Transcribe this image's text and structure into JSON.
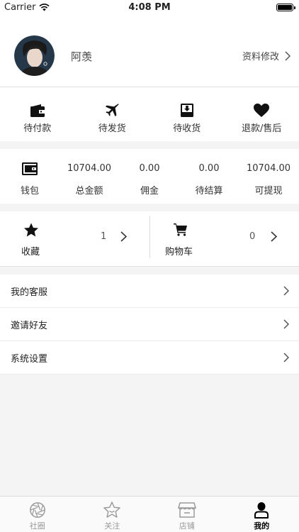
{
  "status_bar": {
    "carrier": "Carrier",
    "time": "4:08 PM"
  },
  "profile": {
    "name": "阿羡",
    "edit_label": "资料修改"
  },
  "orders": [
    {
      "label": "待付款",
      "icon": "wallet-icon"
    },
    {
      "label": "待发货",
      "icon": "airplane-icon"
    },
    {
      "label": "待收货",
      "icon": "inbox-download-icon"
    },
    {
      "label": "退款/售后",
      "icon": "heart-icon"
    }
  ],
  "wallet": {
    "label": "钱包",
    "stats": [
      {
        "value": "10704.00",
        "label": "总金额"
      },
      {
        "value": "0.00",
        "label": "佣金"
      },
      {
        "value": "0.00",
        "label": "待结算"
      },
      {
        "value": "10704.00",
        "label": "可提现"
      }
    ]
  },
  "favorites": {
    "label": "收藏",
    "count": "1"
  },
  "cart": {
    "label": "购物车",
    "count": "0"
  },
  "menu": [
    {
      "label": "我的客服"
    },
    {
      "label": "邀请好友"
    },
    {
      "label": "系统设置"
    }
  ],
  "tabs": [
    {
      "label": "社圈",
      "icon": "aperture-icon",
      "active": false
    },
    {
      "label": "关注",
      "icon": "star-icon",
      "active": false
    },
    {
      "label": "店铺",
      "icon": "store-icon",
      "active": false
    },
    {
      "label": "我的",
      "icon": "user-icon",
      "active": true
    }
  ],
  "colors": {
    "background": "#f4f4f4",
    "panel": "#ffffff",
    "tab_inactive": "#9a9a9a",
    "tab_active": "#000000"
  }
}
